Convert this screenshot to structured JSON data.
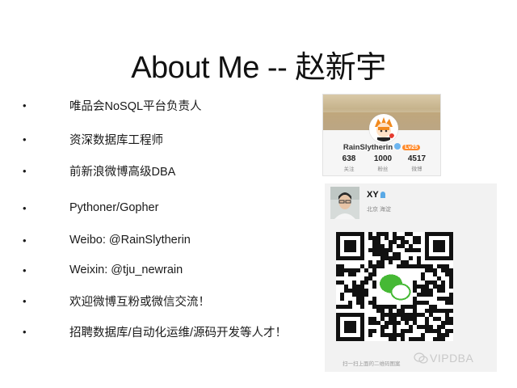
{
  "slide": {
    "title": "About Me -- 赵新宇"
  },
  "bullets": [
    {
      "marker": "•",
      "text": "唯品会NoSQL平台负责人"
    },
    {
      "marker": "•",
      "text": "资深数据库工程师"
    },
    {
      "marker": "•",
      "text": "前新浪微博高级DBA"
    },
    {
      "marker": "•",
      "text": "Pythoner/Gopher"
    },
    {
      "marker": "•",
      "text": "Weibo: @RainSlytherin"
    },
    {
      "marker": "•",
      "text": "Weixin: @tju_newrain"
    },
    {
      "marker": "•",
      "text": "欢迎微博互粉或微信交流！"
    },
    {
      "marker": "•",
      "text": "招聘数据库/自动化运维/源码开发等人才！"
    }
  ],
  "weibo": {
    "username": "RainSlytherin",
    "level_badge": "Lv25",
    "stats": [
      {
        "value": "638",
        "label": "关注"
      },
      {
        "value": "1000",
        "label": "粉丝"
      },
      {
        "value": "4517",
        "label": "微博"
      }
    ]
  },
  "wechat": {
    "name": "XY",
    "region": "北京 海淀",
    "qr_caption": "扫一扫上面的二维码图案",
    "watermark": "VIPDBA"
  },
  "icons": {
    "weibo_verified": "verified-icon",
    "wechat_gender": "male-icon",
    "wechat_logo": "wechat-logo-icon",
    "watermark_logo": "wechat-watermark-icon"
  },
  "colors": {
    "level_badge": "#ff8a2b",
    "wechat_green": "#46b935",
    "verified_blue": "#6cb5f0"
  }
}
